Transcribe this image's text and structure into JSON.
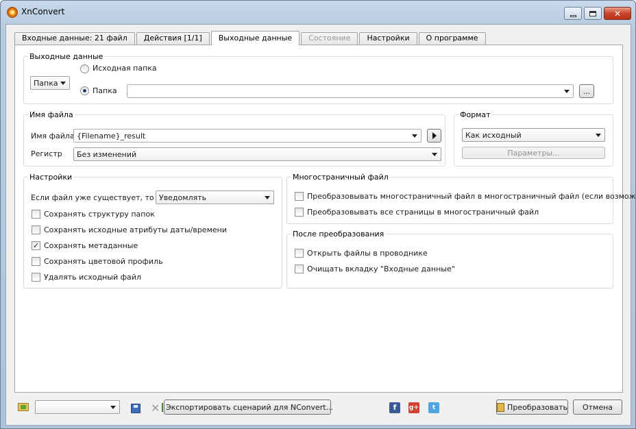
{
  "window": {
    "title": "XnConvert"
  },
  "tabs": [
    {
      "label": "Входные данные: 21 файл",
      "state": "normal"
    },
    {
      "label": "Действия [1/1]",
      "state": "normal"
    },
    {
      "label": "Выходные данные",
      "state": "active"
    },
    {
      "label": "Состояние",
      "state": "disabled"
    },
    {
      "label": "Настройки",
      "state": "normal"
    },
    {
      "label": "О программе",
      "state": "normal"
    }
  ],
  "output": {
    "group_title": "Выходные данные",
    "location_combo": "Папка",
    "radio_source_label": "Исходная папка",
    "radio_folder_label": "Папка",
    "folder_path": "",
    "browse_label": "..."
  },
  "filename": {
    "group_title": "Имя файла",
    "name_label": "Имя файла",
    "name_value": "{Filename}_result",
    "case_label": "Регистр",
    "case_value": "Без изменений"
  },
  "format": {
    "group_title": "Формат",
    "value": "Как исходный",
    "params_label": "Параметры..."
  },
  "settings": {
    "group_title": "Настройки",
    "exists_label": "Если файл уже существует, то",
    "exists_value": "Уведомлять",
    "options": [
      {
        "label": "Сохранять структуру папок",
        "checked": false
      },
      {
        "label": "Сохранять исходные атрибуты даты/времени",
        "checked": false
      },
      {
        "label": "Сохранять метаданные",
        "checked": true
      },
      {
        "label": "Сохранять цветовой профиль",
        "checked": false
      },
      {
        "label": "Удалять исходный файл",
        "checked": false
      }
    ]
  },
  "multipage": {
    "group_title": "Многостраничный файл",
    "options": [
      {
        "label": "Преобразовывать многостраничный файл в многостраничный файл (если возможно)",
        "checked": false
      },
      {
        "label": "Преобразовывать все страницы в многостраничный файл",
        "checked": false
      }
    ]
  },
  "after": {
    "group_title": "После преобразования",
    "options": [
      {
        "label": "Открыть файлы в проводнике",
        "checked": false
      },
      {
        "label": "Очищать вкладку \"Входные данные\"",
        "checked": false
      }
    ]
  },
  "bottom": {
    "preset_value": "",
    "export_label": "Экспортировать сценарий для NConvert...",
    "facebook_glyph": "f",
    "googleplus_glyph": "g+",
    "twitter_glyph": "t",
    "convert_label": "Преобразовать",
    "cancel_label": "Отмена"
  },
  "colors": {
    "titlebar": "#b7cbe0",
    "close_button": "#c9452a",
    "panel_bg": "#ffffff",
    "dialog_bg": "#f0f0f0"
  }
}
